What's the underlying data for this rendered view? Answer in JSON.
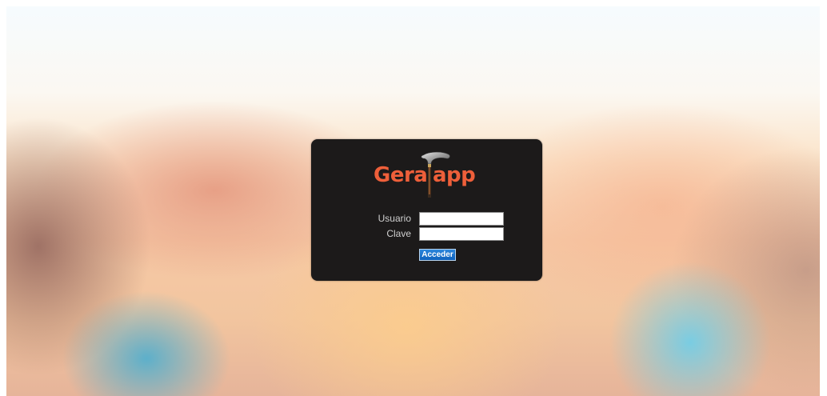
{
  "app": {
    "logo_left": "Gera",
    "logo_right": "app"
  },
  "login_form": {
    "username_label": "Usuario",
    "username_value": "",
    "password_label": "Clave",
    "password_value": "",
    "submit_label": "Acceder"
  },
  "colors": {
    "card_background": "#1c1a1a",
    "logo_orange": "#ee5f3a",
    "button_blue": "#1a70cc",
    "label_gray": "#cfcfcf"
  },
  "icons": {
    "logo_mark": "walking-cane-icon"
  }
}
